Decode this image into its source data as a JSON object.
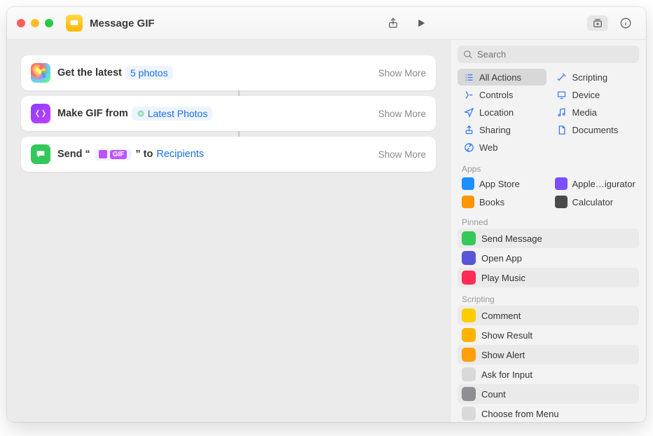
{
  "header": {
    "title": "Message GIF"
  },
  "search": {
    "placeholder": "Search"
  },
  "actions": [
    {
      "icon": "photos",
      "prefix": "Get the latest",
      "token": "5 photos",
      "suffix": "",
      "token2": "",
      "show_more": "Show More"
    },
    {
      "icon": "gif",
      "prefix": "Make GIF from",
      "token": "Latest Photos",
      "suffix": "",
      "token2": "",
      "show_more": "Show More",
      "token_icon": "photos"
    },
    {
      "icon": "msg",
      "prefix": "Send “",
      "token_special": "GIF",
      "mid": "” to",
      "token2": "Recipients",
      "show_more": "Show More"
    }
  ],
  "categories": [
    {
      "label": "All Actions",
      "icon": "list",
      "color": "#3478f6",
      "selected": true
    },
    {
      "label": "Scripting",
      "icon": "wand",
      "color": "#3478f6"
    },
    {
      "label": "Controls",
      "icon": "controls",
      "color": "#3478f6"
    },
    {
      "label": "Device",
      "icon": "device",
      "color": "#3478f6"
    },
    {
      "label": "Location",
      "icon": "location",
      "color": "#3478f6"
    },
    {
      "label": "Media",
      "icon": "media",
      "color": "#3478f6"
    },
    {
      "label": "Sharing",
      "icon": "sharing",
      "color": "#3478f6"
    },
    {
      "label": "Documents",
      "icon": "documents",
      "color": "#3478f6"
    },
    {
      "label": "Web",
      "icon": "web",
      "color": "#3478f6"
    }
  ],
  "apps_label": "Apps",
  "apps": [
    {
      "label": "App Store",
      "color": "#1f8fff"
    },
    {
      "label": "Apple…igurator",
      "color": "#7a4fff"
    },
    {
      "label": "Books",
      "color": "#ff9500"
    },
    {
      "label": "Calculator",
      "color": "#4a4a4a"
    }
  ],
  "pinned_label": "Pinned",
  "pinned": [
    {
      "label": "Send Message",
      "color": "#34c759"
    },
    {
      "label": "Open App",
      "color": "#5856d6"
    },
    {
      "label": "Play Music",
      "color": "#ff2d55"
    }
  ],
  "scripting_label": "Scripting",
  "scripting": [
    {
      "label": "Comment",
      "color": "#ffcc00"
    },
    {
      "label": "Show Result",
      "color": "#ffb300"
    },
    {
      "label": "Show Alert",
      "color": "#ff9f0a"
    },
    {
      "label": "Ask for Input",
      "color": "#d9d9d9"
    },
    {
      "label": "Count",
      "color": "#8e8e93"
    },
    {
      "label": "Choose from Menu",
      "color": "#d9d9d9"
    }
  ]
}
